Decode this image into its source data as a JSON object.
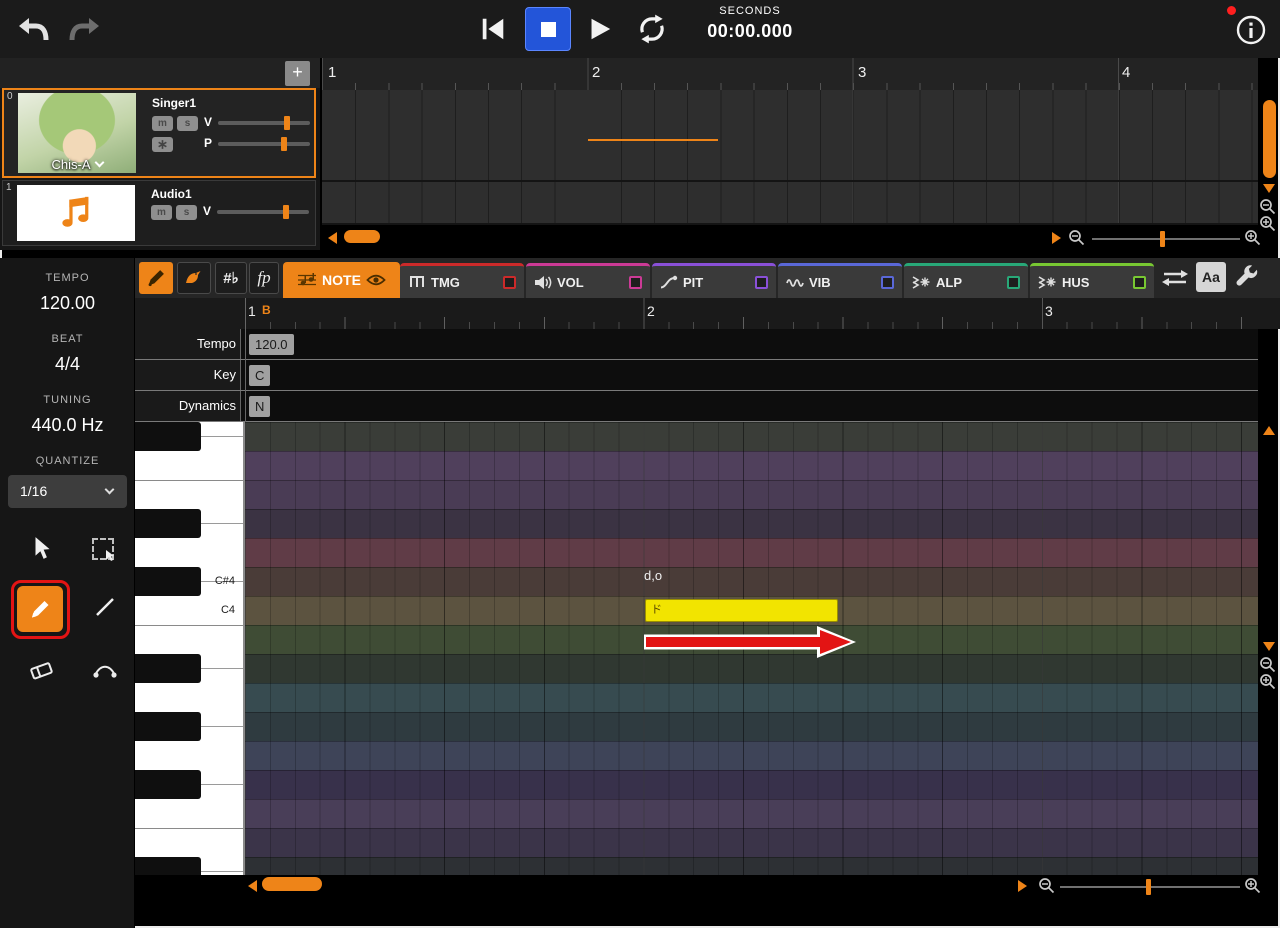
{
  "colors": {
    "accent": "#ee8418",
    "note_fill": "#f2e400",
    "stop_active": "#2355d9",
    "annotation": "#e31414"
  },
  "transport": {
    "time_unit": "SECONDS",
    "time_value": "00:00.000"
  },
  "track_panel": {
    "add_button": "+",
    "tracks": [
      {
        "index": "0",
        "name": "Singer1",
        "voice_name": "Chis-A",
        "mute": "m",
        "solo": "s",
        "volume_label": "V",
        "pan_label": "P"
      },
      {
        "index": "1",
        "name": "Audio1",
        "mute": "m",
        "solo": "s",
        "volume_label": "V"
      }
    ]
  },
  "timeline": {
    "ruler": [
      "1",
      "2",
      "3",
      "4"
    ]
  },
  "left_panel": {
    "tempo": {
      "label": "TEMPO",
      "value": "120.00"
    },
    "beat": {
      "label": "BEAT",
      "value": "4/4"
    },
    "tuning": {
      "label": "TUNING",
      "value": "440.0 Hz"
    },
    "quantize": {
      "label": "QUANTIZE",
      "value": "1/16"
    }
  },
  "toolbar": {
    "accidental_label": "#♭",
    "dynamics_label": "fp",
    "note_tab_label": "NOTE",
    "text_button_label": "Aa",
    "tabs": [
      {
        "label": "TMG",
        "color": "#cc2a2a"
      },
      {
        "label": "VOL",
        "color": "#cc3a96"
      },
      {
        "label": "PIT",
        "color": "#8a50d8"
      },
      {
        "label": "VIB",
        "color": "#5a68d8"
      },
      {
        "label": "ALP",
        "color": "#28a878"
      },
      {
        "label": "HUS",
        "color": "#78c832"
      }
    ]
  },
  "editor": {
    "ruler": {
      "m1": "1",
      "marker": "B",
      "m2": "2",
      "m3": "3"
    },
    "params": [
      {
        "label": "Tempo",
        "value": "120.0"
      },
      {
        "label": "Key",
        "value": "C"
      },
      {
        "label": "Dynamics",
        "value": "N"
      }
    ],
    "note": {
      "lyric": "ド",
      "phoneme": "d,o"
    },
    "pitch_rows": [
      {
        "pitch": "F#4",
        "key": "black",
        "color": "#3a3d38"
      },
      {
        "pitch": "F4",
        "key": "white",
        "color": "#50405c"
      },
      {
        "pitch": "E4",
        "key": "white",
        "color": "#4a3c55",
        "boundary": true
      },
      {
        "pitch": "D#4",
        "key": "black",
        "color": "#3b3343"
      },
      {
        "pitch": "D4",
        "key": "white",
        "color": "#603c47"
      },
      {
        "pitch": "C#4",
        "key": "black",
        "color": "#4a3c38",
        "label": "C#4"
      },
      {
        "pitch": "C4",
        "key": "white",
        "color": "#5c5340",
        "label": "C4"
      },
      {
        "pitch": "B3",
        "key": "white",
        "color": "#3f4c35",
        "boundary": true
      },
      {
        "pitch": "A#3",
        "key": "black",
        "color": "#303831"
      },
      {
        "pitch": "A3",
        "key": "white",
        "color": "#374b50"
      },
      {
        "pitch": "G#3",
        "key": "black",
        "color": "#2f3b40"
      },
      {
        "pitch": "G3",
        "key": "white",
        "color": "#3e4458"
      },
      {
        "pitch": "F#3",
        "key": "black",
        "color": "#38314b"
      },
      {
        "pitch": "F3",
        "key": "white",
        "color": "#493e58"
      },
      {
        "pitch": "E3",
        "key": "white",
        "color": "#3b3449",
        "boundary": true
      },
      {
        "pitch": "D#3",
        "key": "black",
        "color": "#2d3034"
      }
    ]
  }
}
